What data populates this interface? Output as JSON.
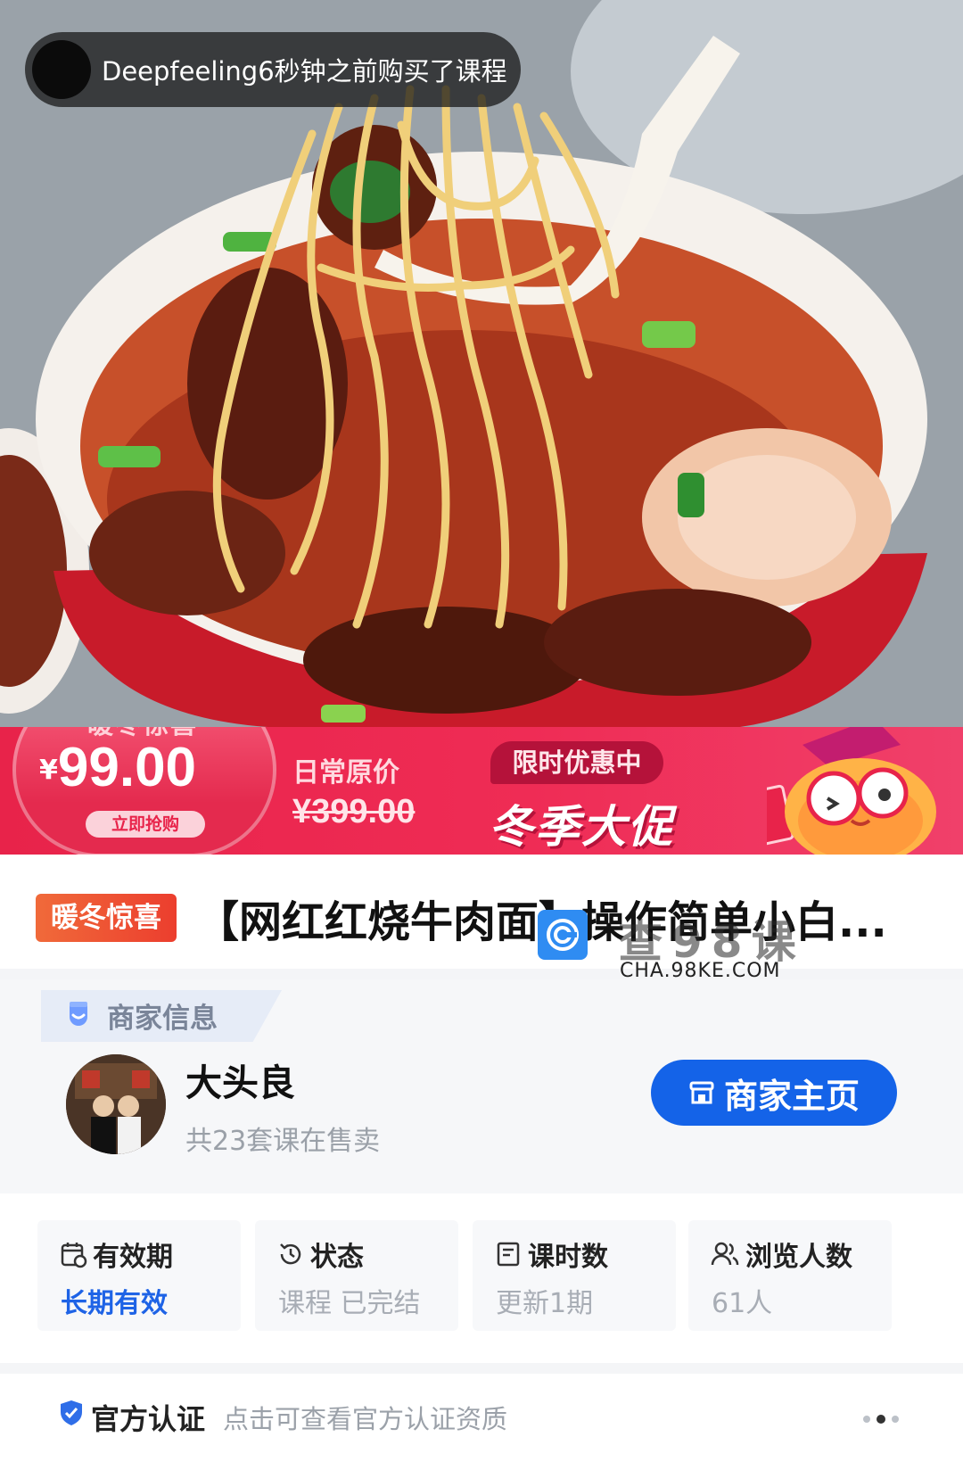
{
  "hero": {
    "buyer_notice": "Deepfeeling6秒钟之前购买了课程",
    "image_alt": "red-braised beef noodles"
  },
  "banner": {
    "tag": "暖冬惊喜",
    "currency": "¥",
    "price": "99.00",
    "buy_button": "立即抢购",
    "original_label": "日常原价",
    "original_price": "¥399.00",
    "limited_label": "限时优惠中",
    "sale_text": "冬季大促"
  },
  "title": {
    "badge": "暖冬惊喜",
    "text": "【网红红烧牛肉面】操作简单小白..."
  },
  "watermark": {
    "cn": "查98课",
    "en": "CHA.98KE.COM"
  },
  "merchant": {
    "section_label": "商家信息",
    "name": "大头良",
    "course_count": "共23套课在售卖",
    "home_button": "商家主页"
  },
  "stats": [
    {
      "icon": "calendar-icon",
      "label": "有效期",
      "value": "长期有效",
      "highlight": true
    },
    {
      "icon": "clock-icon",
      "label": "状态",
      "value": "课程 已完结",
      "highlight": false
    },
    {
      "icon": "document-icon",
      "label": "课时数",
      "value": "更新1期",
      "highlight": false
    },
    {
      "icon": "users-icon",
      "label": "浏览人数",
      "value": "61人",
      "highlight": false
    }
  ],
  "certification": {
    "title": "官方认证",
    "description": "点击可查看官方认证资质",
    "shield_color": "#2f6ee8"
  },
  "colors": {
    "accent_blue": "#1463e8",
    "promo_red": "#e8234a"
  }
}
